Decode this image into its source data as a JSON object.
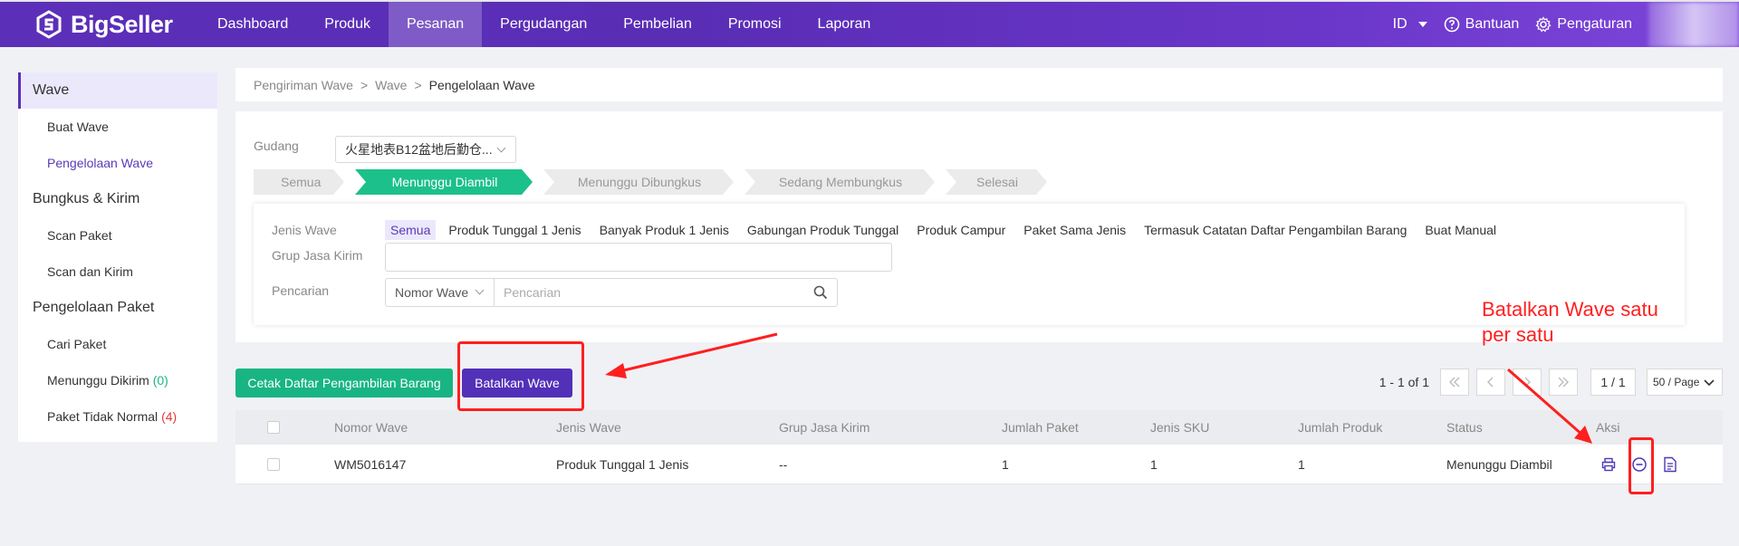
{
  "app": {
    "name": "BigSeller"
  },
  "nav": {
    "items": [
      "Dashboard",
      "Produk",
      "Pesanan",
      "Pergudangan",
      "Pembelian",
      "Promosi",
      "Laporan"
    ],
    "active": "Pesanan",
    "lang": "ID",
    "help": "Bantuan",
    "settings": "Pengaturan"
  },
  "sidebar": {
    "wave_group": "Wave",
    "buat_wave": "Buat Wave",
    "pengelolaan_wave": "Pengelolaan Wave",
    "bungkus_group": "Bungkus & Kirim",
    "scan_paket": "Scan Paket",
    "scan_kirim": "Scan dan Kirim",
    "paket_group": "Pengelolaan Paket",
    "cari_paket": "Cari Paket",
    "menunggu_dikirim": "Menunggu Dikirim",
    "menunggu_dikirim_count": "(0)",
    "paket_tidak_normal": "Paket Tidak Normal",
    "paket_tidak_normal_count": "(4)"
  },
  "breadcrumb": {
    "c1": "Pengiriman Wave",
    "c2": "Wave",
    "c3": "Pengelolaan Wave",
    "sep": ">"
  },
  "filters": {
    "gudang_label": "Gudang",
    "gudang_value": "火星地表B12盆地后勤仓...",
    "steps": [
      "Semua",
      "Menunggu Diambil",
      "Menunggu Dibungkus",
      "Sedang Membungkus",
      "Selesai"
    ],
    "active_step": "Menunggu Diambil",
    "jenis_label": "Jenis Wave",
    "jenis_options": [
      "Semua",
      "Produk Tunggal 1 Jenis",
      "Banyak Produk 1 Jenis",
      "Gabungan Produk Tunggal",
      "Produk Campur",
      "Paket Sama Jenis",
      "Termasuk Catatan Daftar Pengambilan Barang",
      "Buat Manual"
    ],
    "grup_label": "Grup Jasa Kirim",
    "pencarian_label": "Pencarian",
    "search_type": "Nomor Wave",
    "search_placeholder": "Pencarian"
  },
  "actions": {
    "print_btn": "Cetak Daftar Pengambilan Barang",
    "cancel_btn": "Batalkan Wave"
  },
  "pager": {
    "info": "1 - 1 of 1",
    "page": "1 / 1",
    "size": "50 / Page"
  },
  "table": {
    "headers": [
      "Nomor Wave",
      "Jenis Wave",
      "Grup Jasa Kirim",
      "Jumlah Paket",
      "Jenis SKU",
      "Jumlah Produk",
      "Status",
      "Aksi"
    ],
    "rows": [
      {
        "nomor": "WM5016147",
        "jenis": "Produk Tunggal 1 Jenis",
        "grup": "--",
        "paket": "1",
        "sku": "1",
        "produk": "1",
        "status": "Menunggu Diambil"
      }
    ]
  },
  "annotation": {
    "line1": "Batalkan Wave satu",
    "line2": "per satu"
  },
  "colors": {
    "brand_purple": "#5b2fb8",
    "green": "#18b583",
    "annotation_red": "#ff1f1f"
  }
}
